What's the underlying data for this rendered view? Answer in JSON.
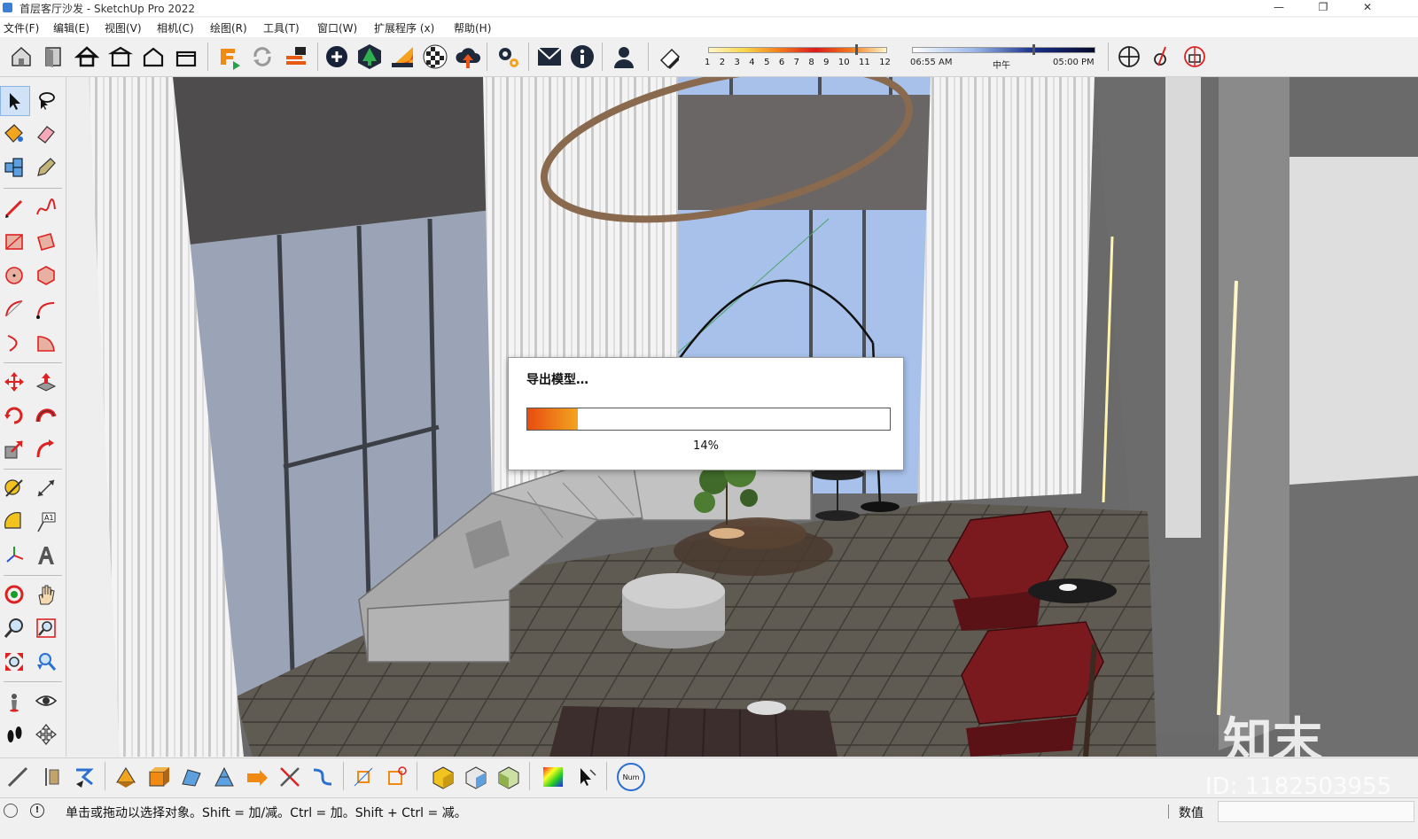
{
  "window": {
    "title": "首层客厅沙发 - SketchUp Pro 2022",
    "controls": [
      "—",
      "❐",
      "✕"
    ]
  },
  "menu": [
    "文件(F)",
    "编辑(E)",
    "视图(V)",
    "相机(C)",
    "绘图(R)",
    "工具(T)",
    "窗口(W)",
    "扩展程序 (x)",
    "帮助(H)"
  ],
  "shadow": {
    "months": [
      "1",
      "2",
      "3",
      "4",
      "5",
      "6",
      "7",
      "8",
      "9",
      "10",
      "11",
      "12"
    ],
    "time_start": "06:55 AM",
    "time_mid": "中午",
    "time_end": "05:00 PM"
  },
  "dialog": {
    "title": "导出模型…",
    "percent_label": "14%",
    "progress": 0.14
  },
  "status": {
    "message": "单击或拖动以选择对象。Shift = 加/减。Ctrl = 加。Shift + Ctrl = 减。",
    "value_label": "数值"
  },
  "num_label": "Num",
  "overlay": {
    "logo": "知末",
    "id_text": "ID: 1182503955"
  },
  "colors": {
    "accent": "#e84c10",
    "accent2": "#f2a51f",
    "sky": "#9bb6e0",
    "chair": "#7a1a1e"
  }
}
